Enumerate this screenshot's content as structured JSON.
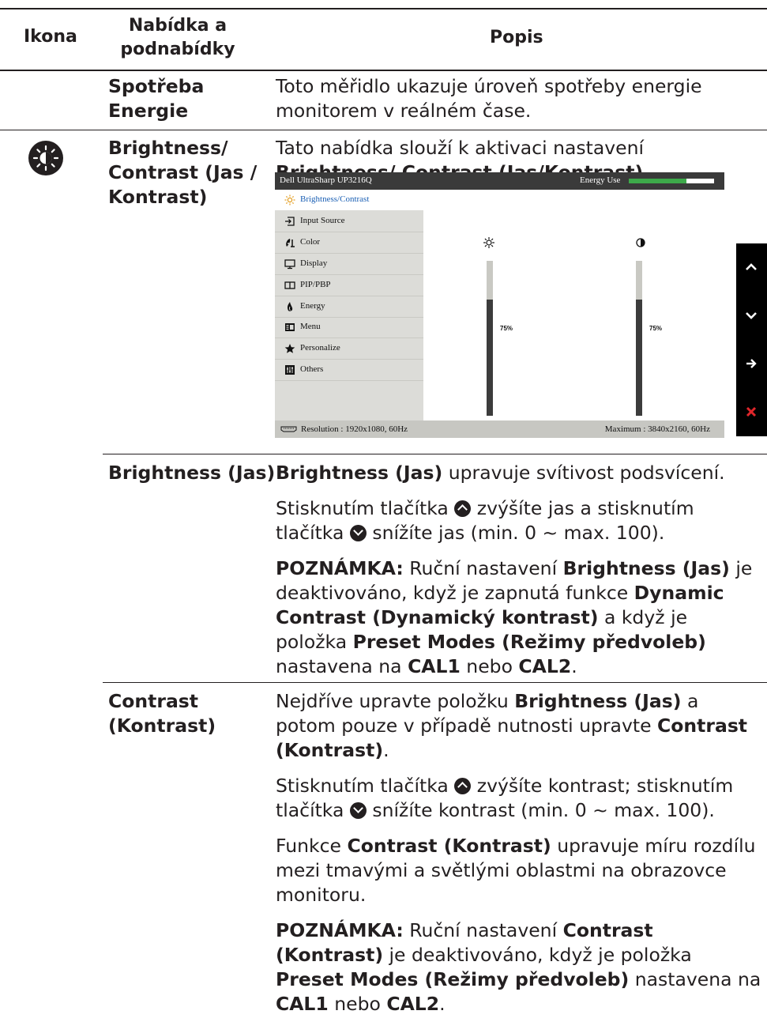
{
  "header": {
    "col_icon": "Ikona",
    "col_menu": "Nabídka a podnabídky",
    "col_desc": "Popis"
  },
  "rows": {
    "energy": {
      "menu": "Spotřeba Energie",
      "desc": "Toto měřidlo ukazuje úroveň spotřeby energie monitorem v reálném čase."
    },
    "brightness_contrast": {
      "icon": "brightness-icon",
      "menu": "Brightness/ Contrast (Jas / Kontrast)",
      "desc_prefix": "Tato nabídka slouží k aktivaci nastavení ",
      "desc_bold": "Brightness/ Contrast (Jas/Kontrast)",
      "desc_suffix": "."
    },
    "brightness": {
      "menu": "Brightness (Jas)",
      "p1_bold": "Brightness (Jas)",
      "p1_rest": " upravuje svítivost podsvícení.",
      "p2_a": "Stisknutím tlačítka ",
      "p2_b": " zvýšíte jas a stisknutím tlačítka ",
      "p2_c": " snížíte jas (min. 0 ~ max. 100).",
      "note_label": "POZNÁMKA:",
      "note_1": " Ruční nastavení ",
      "note_b1": "Brightness (Jas)",
      "note_2": " je deaktivováno, když je zapnutá funkce ",
      "note_b2": "Dynamic Contrast (Dynamický kontrast)",
      "note_3": " a když je položka ",
      "note_b3": "Preset Modes (Režimy předvoleb)",
      "note_4": " nastavena na ",
      "note_b4": "CAL1",
      "note_5": " nebo ",
      "note_b5": "CAL2",
      "note_6": "."
    },
    "contrast": {
      "menu": "Contrast (Kontrast)",
      "p1_a": "Nejdříve upravte položku ",
      "p1_b1": "Brightness (Jas)",
      "p1_c": " a potom pouze v případě nutnosti upravte ",
      "p1_b2": "Contrast (Kontrast)",
      "p1_d": ".",
      "p2_a": "Stisknutím tlačítka ",
      "p2_b": " zvýšíte kontrast; stisknutím tlačítka ",
      "p2_c": " snížíte kontrast (min. 0 ~ max. 100).",
      "p3_a": "Funkce ",
      "p3_b": "Contrast (Kontrast)",
      "p3_c": " upravuje míru rozdílu mezi tmavými a světlými oblastmi na obrazovce monitoru.",
      "note_label": "POZNÁMKA:",
      "note_1": " Ruční nastavení ",
      "note_b1": "Contrast (Kontrast)",
      "note_2": " je deaktivováno, když je položka ",
      "note_b2": "Preset Modes (Režimy předvoleb)",
      "note_3": " nastavena na ",
      "note_b3": "CAL1",
      "note_4": " nebo ",
      "note_b4": "CAL2",
      "note_5": "."
    }
  },
  "osd": {
    "model": "Dell UltraSharp UP3216Q",
    "energy_label": "Energy Use",
    "energy_level": 0.68,
    "menu": [
      {
        "label": "Brightness/Contrast",
        "icon": "sun-icon",
        "selected": true
      },
      {
        "label": "Input Source",
        "icon": "input-icon"
      },
      {
        "label": "Color",
        "icon": "color-icon"
      },
      {
        "label": "Display",
        "icon": "display-icon"
      },
      {
        "label": "PIP/PBP",
        "icon": "pip-icon"
      },
      {
        "label": "Energy",
        "icon": "energy-icon"
      },
      {
        "label": "Menu",
        "icon": "menu-icon"
      },
      {
        "label": "Personalize",
        "icon": "star-icon"
      },
      {
        "label": "Others",
        "icon": "others-icon"
      }
    ],
    "brightness_value": "75%",
    "brightness_level": 75,
    "contrast_value": "75%",
    "contrast_level": 75,
    "resolution": "Resolution : 1920x1080, 60Hz",
    "maximum": "Maximum : 3840x2160, 60Hz",
    "side_buttons": [
      "up-arrow-icon",
      "down-arrow-icon",
      "right-arrow-icon",
      "close-icon"
    ],
    "close_color": "#e0262b",
    "energy_color": "#3daa4a"
  }
}
